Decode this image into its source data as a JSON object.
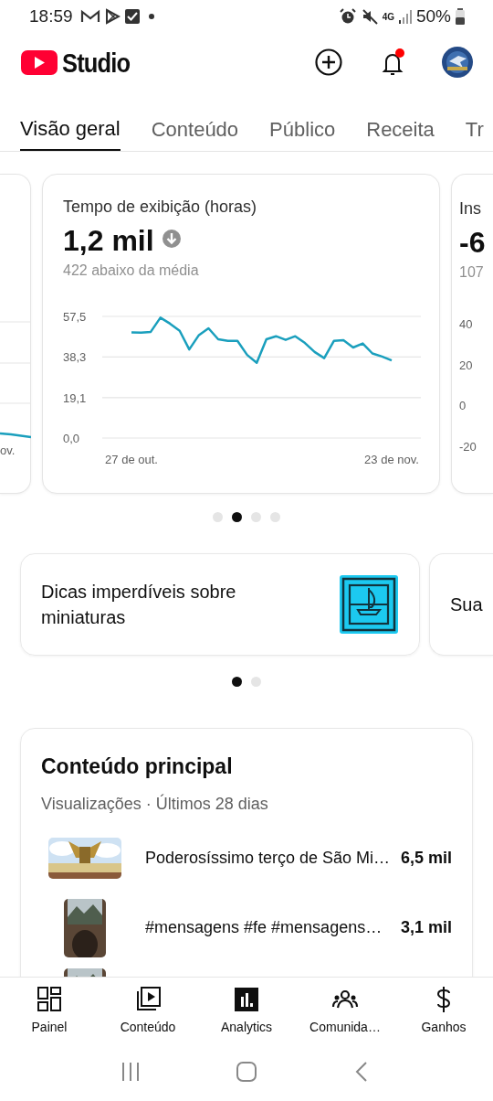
{
  "status_bar": {
    "time": "18:59",
    "network": "4G",
    "battery": "50%"
  },
  "header": {
    "logo": "Studio",
    "has_notification": true
  },
  "tabs": [
    {
      "label": "Visão geral",
      "selected": true
    },
    {
      "label": "Conteúdo",
      "selected": false
    },
    {
      "label": "Público",
      "selected": false
    },
    {
      "label": "Receita",
      "selected": false
    },
    {
      "label": "Tr",
      "selected": false
    }
  ],
  "stat_cards": [
    {
      "kind": "partial_left",
      "x_label": "ov."
    },
    {
      "kind": "full",
      "title": "Tempo de exibição (horas)",
      "value": "1,2 mil",
      "below_average": true,
      "note": "422 abaixo da média",
      "chart_data": {
        "type": "line",
        "categories": [
          "27 de out.",
          null,
          null,
          null,
          null,
          null,
          null,
          null,
          null,
          null,
          null,
          null,
          null,
          null,
          null,
          null,
          null,
          null,
          null,
          null,
          null,
          null,
          null,
          null,
          null,
          null,
          null,
          "23 de nov."
        ],
        "ylim": [
          0,
          57.5
        ],
        "yticks": [
          {
            "value": 0,
            "label": "0,0"
          },
          {
            "value": 19.1,
            "label": "19,1"
          },
          {
            "value": 38.3,
            "label": "38,3"
          },
          {
            "value": 57.5,
            "label": "57,5"
          }
        ],
        "series": [
          {
            "color": "#1a9fbd",
            "values": [
              49.9,
              49.8,
              50.2,
              56.9,
              54.1,
              50.7,
              41.9,
              48.7,
              51.9,
              46.7,
              45.9,
              45.9,
              39.3,
              35.6,
              46.7,
              48.1,
              46.4,
              48.1,
              44.9,
              40.7,
              37.8,
              45.9,
              46.2,
              42.8,
              44.7,
              40.0,
              38.5,
              36.7
            ]
          }
        ]
      }
    },
    {
      "kind": "partial_right",
      "title": "Ins",
      "value": "-6",
      "note": "107",
      "tick_labels": [
        "40",
        "20",
        "0",
        "-20"
      ]
    }
  ],
  "stat_pager": [
    {
      "selected": false
    },
    {
      "selected": true
    },
    {
      "selected": false
    },
    {
      "selected": false
    }
  ],
  "tips": [
    {
      "kind": "full",
      "title": "Dicas imperdíveis sobre miniaturas"
    },
    {
      "kind": "partial",
      "title": "Sua"
    }
  ],
  "tips_pager": [
    {
      "selected": true
    },
    {
      "selected": false
    }
  ],
  "top_content": {
    "title": "Conteúdo principal",
    "subtitle": "Visualizações · Últimos 28 dias",
    "rows": [
      {
        "kind": "wide",
        "title": "Poderosíssimo terço de São Mi…",
        "views": "6,5 mil"
      },
      {
        "kind": "tall",
        "title": "#mensagens #fe #mensagens…",
        "views": "3,1 mil"
      },
      {
        "kind": "tall"
      }
    ]
  },
  "bottom_nav": [
    {
      "kind": "dashboard",
      "label": "Painel",
      "selected": false
    },
    {
      "kind": "content",
      "label": "Conteúdo",
      "selected": false
    },
    {
      "kind": "analytics",
      "label": "Analytics",
      "selected": true
    },
    {
      "kind": "community",
      "label": "Comunida…",
      "selected": false
    },
    {
      "kind": "earnings",
      "label": "Ganhos",
      "selected": false
    }
  ]
}
